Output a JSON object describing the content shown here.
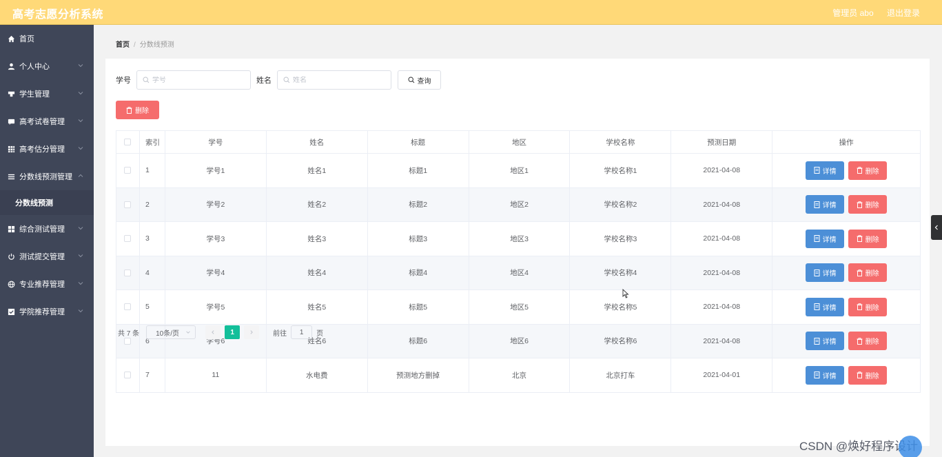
{
  "header": {
    "title": "高考志愿分析系统",
    "admin_label": "管理员 abo",
    "logout_label": "退出登录"
  },
  "sidebar": {
    "items": [
      {
        "label": "首页",
        "icon": "home-icon",
        "has_children": false
      },
      {
        "label": "个人中心",
        "icon": "user-icon",
        "has_children": true
      },
      {
        "label": "学生管理",
        "icon": "mic-icon",
        "has_children": true
      },
      {
        "label": "高考试卷管理",
        "icon": "chat-icon",
        "has_children": true
      },
      {
        "label": "高考估分管理",
        "icon": "grid-icon",
        "has_children": true
      },
      {
        "label": "分数线预测管理",
        "icon": "list-icon",
        "has_children": true,
        "expanded": true
      }
    ],
    "subitem": {
      "label": "分数线预测"
    },
    "items_after": [
      {
        "label": "综合测试管理",
        "icon": "apps-icon",
        "has_children": true
      },
      {
        "label": "测试提交管理",
        "icon": "power-icon",
        "has_children": true
      },
      {
        "label": "专业推荐管理",
        "icon": "globe-icon",
        "has_children": true
      },
      {
        "label": "学院推荐管理",
        "icon": "check-square-icon",
        "has_children": true
      }
    ]
  },
  "breadcrumb": {
    "home": "首页",
    "current": "分数线预测"
  },
  "search": {
    "id_label": "学号",
    "id_placeholder": "学号",
    "name_label": "姓名",
    "name_placeholder": "姓名",
    "query_label": "查询"
  },
  "bulk_delete_label": "删除",
  "table": {
    "headers": [
      "索引",
      "学号",
      "姓名",
      "标题",
      "地区",
      "学校名称",
      "预测日期",
      "操作"
    ],
    "rows": [
      {
        "idx": "1",
        "id": "学号1",
        "name": "姓名1",
        "title": "标题1",
        "region": "地区1",
        "school": "学校名称1",
        "date": "2021-04-08"
      },
      {
        "idx": "2",
        "id": "学号2",
        "name": "姓名2",
        "title": "标题2",
        "region": "地区2",
        "school": "学校名称2",
        "date": "2021-04-08"
      },
      {
        "idx": "3",
        "id": "学号3",
        "name": "姓名3",
        "title": "标题3",
        "region": "地区3",
        "school": "学校名称3",
        "date": "2021-04-08"
      },
      {
        "idx": "4",
        "id": "学号4",
        "name": "姓名4",
        "title": "标题4",
        "region": "地区4",
        "school": "学校名称4",
        "date": "2021-04-08"
      },
      {
        "idx": "5",
        "id": "学号5",
        "name": "姓名5",
        "title": "标题5",
        "region": "地区5",
        "school": "学校名称5",
        "date": "2021-04-08"
      },
      {
        "idx": "6",
        "id": "学号6",
        "name": "姓名6",
        "title": "标题6",
        "region": "地区6",
        "school": "学校名称6",
        "date": "2021-04-08"
      },
      {
        "idx": "7",
        "id": "11",
        "name": "水电费",
        "title": "预测地方删掉",
        "region": "北京",
        "school": "北京打车",
        "date": "2021-04-01"
      }
    ],
    "detail_label": "详情",
    "delete_label": "删除"
  },
  "pagination": {
    "total": "共 7 条",
    "page_size": "10条/页",
    "current_page": "1",
    "goto_prefix": "前往",
    "goto_value": "1",
    "goto_suffix": "页"
  },
  "watermark": "CSDN @焕好程序设计",
  "colors": {
    "header": "#ffd978",
    "sidebar": "#3f4658",
    "danger": "#f56c6c",
    "primary": "#4c8fd7",
    "pager_active": "#13bf9a"
  }
}
